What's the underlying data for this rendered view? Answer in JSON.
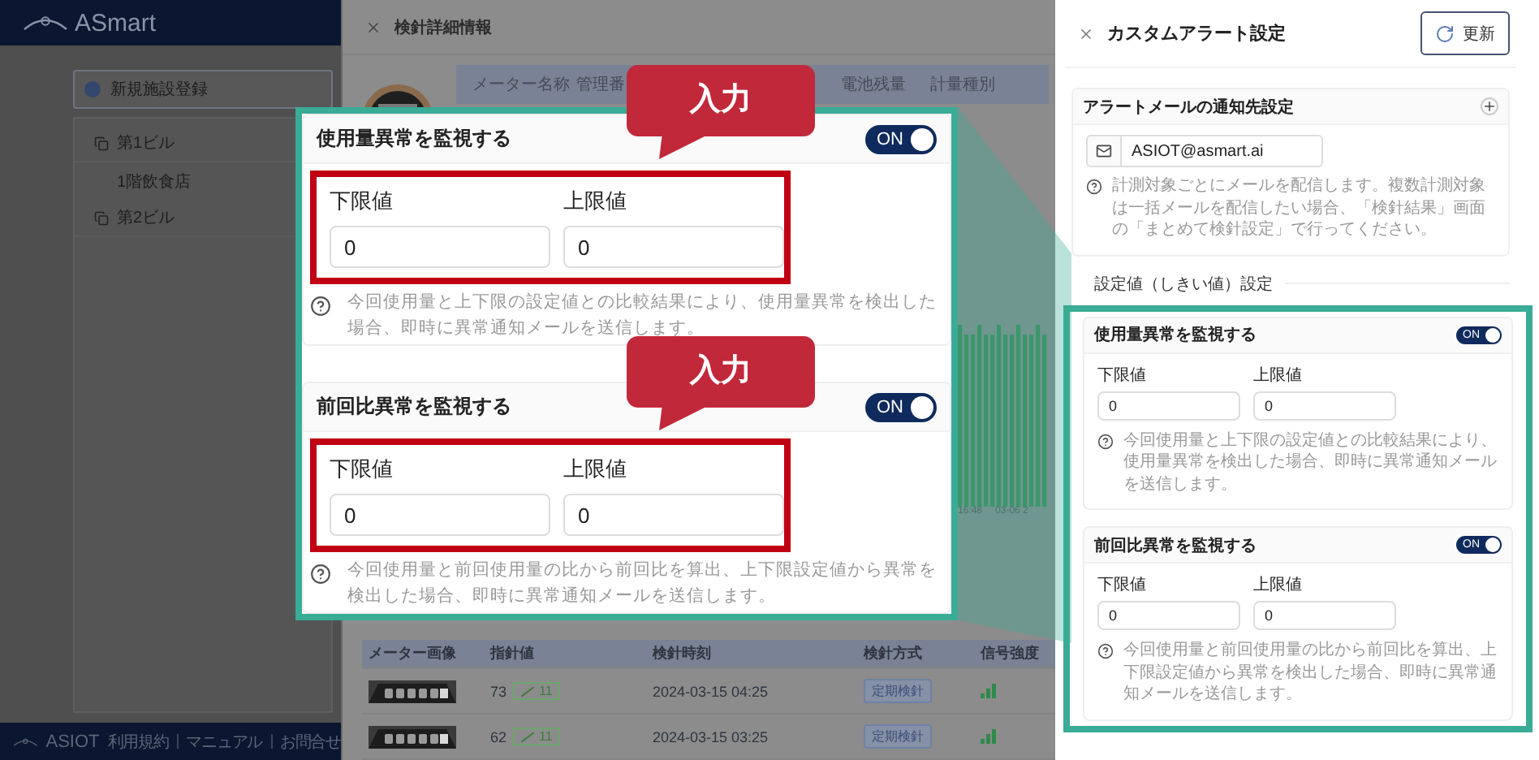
{
  "app": {
    "logo": "ASmart",
    "new_facility_button": "新規施設登録",
    "tree": [
      {
        "label": "第1ビル",
        "children": [
          {
            "label": "1階飲食店"
          }
        ]
      },
      {
        "label": "第2ビル"
      }
    ],
    "footer": {
      "logo": "ASIOT",
      "links": [
        "利用規約",
        "マニュアル",
        "お問合せ"
      ]
    }
  },
  "detail_drawer": {
    "title": "検針詳細情報",
    "meter_columns": [
      "メーター名称",
      "管理番",
      "電池残量",
      "計量種別"
    ],
    "chart_labels": [
      "16:48",
      "03-06 2"
    ],
    "reading_table": {
      "columns": [
        "メーター画像",
        "指針値",
        "検針時刻",
        "検針方式",
        "信号強度"
      ],
      "rows": [
        {
          "reading": "73",
          "delta": "11",
          "time": "2024-03-15 04:25",
          "method": "定期検針"
        },
        {
          "reading": "62",
          "delta": "11",
          "time": "2024-03-15 03:25",
          "method": "定期検針"
        }
      ]
    }
  },
  "alert_panel": {
    "title": "カスタムアラート設定",
    "refresh_button": "更新",
    "email_section": {
      "title": "アラートメールの通知先設定",
      "email": "ASIOT@asmart.ai",
      "help": "計測対象ごとにメールを配信します。複数計測対象は一括メールを配信したい場合、「検針結果」画面の「まとめて検針設定」で行ってください。"
    },
    "threshold_heading": "設定値（しきい値）設定",
    "monitors": [
      {
        "title": "使用量異常を監視する",
        "on": true,
        "toggle_label": "ON",
        "lower_label": "下限値",
        "lower_value": "0",
        "upper_label": "上限値",
        "upper_value": "0",
        "help": "今回使用量と上下限の設定値との比較結果により、使用量異常を検出した場合、即時に異常通知メールを送信します。"
      },
      {
        "title": "前回比異常を監視する",
        "on": true,
        "toggle_label": "ON",
        "lower_label": "下限値",
        "lower_value": "0",
        "upper_label": "上限値",
        "upper_value": "0",
        "help": "今回使用量と前回使用量の比から前回比を算出、上下限設定値から異常を検出した場合、即時に異常通知メールを送信します。"
      }
    ]
  },
  "callout": {
    "badges": [
      "入力",
      "入力"
    ],
    "monitors": [
      {
        "title": "使用量異常を監視する",
        "on": true,
        "toggle_label": "ON",
        "lower_label": "下限値",
        "lower_value": "0",
        "upper_label": "上限値",
        "upper_value": "0",
        "help": "今回使用量と上下限の設定値との比較結果により、使用量異常を検出した場合、即時に異常通知メールを送信します。"
      },
      {
        "title": "前回比異常を監視する",
        "on": true,
        "toggle_label": "ON",
        "lower_label": "下限値",
        "lower_value": "0",
        "upper_label": "上限値",
        "upper_value": "0",
        "help": "今回使用量と前回使用量の比から前回比を算出、上下限設定値から異常を検出した場合、即時に異常通知メールを送信します。"
      }
    ]
  }
}
